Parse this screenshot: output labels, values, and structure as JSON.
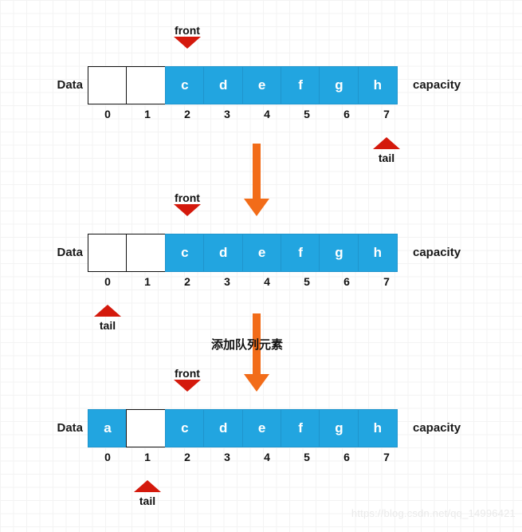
{
  "diagram": {
    "title": "Circular queue array add-element illustration",
    "watermark": "https://blog.csdn.net/qq_14996421",
    "labels": {
      "data": "Data",
      "capacity": "capacity",
      "front": "front",
      "tail": "tail"
    },
    "indices": [
      "0",
      "1",
      "2",
      "3",
      "4",
      "5",
      "6",
      "7"
    ],
    "colors": {
      "filled_cell": "#22a5e0",
      "empty_cell": "#ffffff",
      "cell_border": "#111111",
      "pointer": "#d4190c",
      "flow_arrow": "#f26c19",
      "text": "#111111",
      "grid_minor": "#f3f3f3",
      "grid_major": "#e4e4e4"
    },
    "rows": [
      {
        "id": "row-1",
        "data_label": "Data",
        "capacity_label": "capacity",
        "cells": [
          {
            "value": "",
            "filled": false
          },
          {
            "value": "",
            "filled": false
          },
          {
            "value": "c",
            "filled": true
          },
          {
            "value": "d",
            "filled": true
          },
          {
            "value": "e",
            "filled": true
          },
          {
            "value": "f",
            "filled": true
          },
          {
            "value": "g",
            "filled": true
          },
          {
            "value": "h",
            "filled": true
          }
        ],
        "front_index": 2,
        "tail_index": 7
      },
      {
        "id": "row-2",
        "data_label": "Data",
        "capacity_label": "capacity",
        "cells": [
          {
            "value": "",
            "filled": false
          },
          {
            "value": "",
            "filled": false
          },
          {
            "value": "c",
            "filled": true
          },
          {
            "value": "d",
            "filled": true
          },
          {
            "value": "e",
            "filled": true
          },
          {
            "value": "f",
            "filled": true
          },
          {
            "value": "g",
            "filled": true
          },
          {
            "value": "h",
            "filled": true
          }
        ],
        "front_index": 2,
        "tail_index": 0
      },
      {
        "id": "row-3",
        "data_label": "Data",
        "capacity_label": "capacity",
        "cells": [
          {
            "value": "a",
            "filled": true
          },
          {
            "value": "",
            "filled": false
          },
          {
            "value": "c",
            "filled": true
          },
          {
            "value": "d",
            "filled": true
          },
          {
            "value": "e",
            "filled": true
          },
          {
            "value": "f",
            "filled": true
          },
          {
            "value": "g",
            "filled": true
          },
          {
            "value": "h",
            "filled": true
          }
        ],
        "front_index": 2,
        "tail_index": 1
      }
    ],
    "flows": [
      {
        "id": "flow-1",
        "text": ""
      },
      {
        "id": "flow-2",
        "text": "添加队列元素"
      }
    ]
  }
}
